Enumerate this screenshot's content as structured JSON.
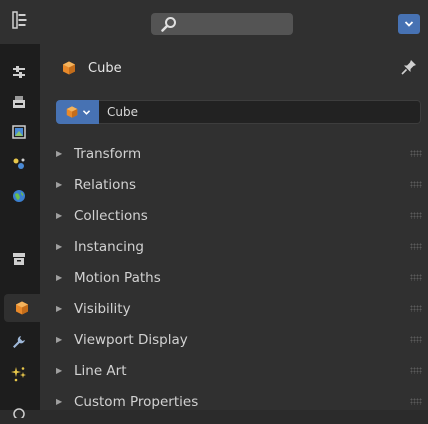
{
  "context": {
    "object_name": "Cube",
    "datablock_name": "Cube",
    "object_icon": "object-cube-icon",
    "pin_icon": "pin-icon"
  },
  "toolbar": {
    "editor_type_icon": "properties-editor-icon",
    "search_icon": "search-icon",
    "dropdown_icon": "chevron-down-icon"
  },
  "tabs": [
    {
      "name": "tool-tab",
      "icon": "tool-settings-icon",
      "active": false
    },
    {
      "name": "render-tab",
      "icon": "render-icon",
      "active": false
    },
    {
      "name": "output-tab",
      "icon": "output-icon",
      "active": false
    },
    {
      "name": "view-layer-tab",
      "icon": "view-layer-icon",
      "active": false
    },
    {
      "name": "scene-tab",
      "icon": "scene-icon",
      "active": false
    },
    {
      "name": "world-tab",
      "icon": "world-icon",
      "active": false
    },
    {
      "name": "collection-tab",
      "icon": "collection-icon",
      "active": false
    },
    {
      "name": "object-tab",
      "icon": "object-icon",
      "active": true
    },
    {
      "name": "modifier-tab",
      "icon": "wrench-icon",
      "active": false
    },
    {
      "name": "particles-tab",
      "icon": "particles-icon",
      "active": false
    }
  ],
  "panels": [
    {
      "label": "Transform"
    },
    {
      "label": "Relations"
    },
    {
      "label": "Collections"
    },
    {
      "label": "Instancing"
    },
    {
      "label": "Motion Paths"
    },
    {
      "label": "Visibility"
    },
    {
      "label": "Viewport Display"
    },
    {
      "label": "Line Art"
    },
    {
      "label": "Custom Properties"
    }
  ],
  "colors": {
    "accent": "#4772b3",
    "object_orange": "#e8892a",
    "background": "#303030",
    "tabstrip": "#1d1d1d"
  }
}
